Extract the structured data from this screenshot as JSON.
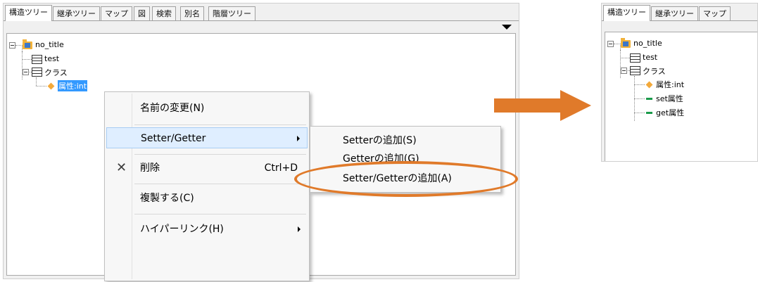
{
  "left_panel": {
    "tabs": [
      "構造ツリー",
      "継承ツリー",
      "マップ",
      "図",
      "検索",
      "別名",
      "階層ツリー"
    ],
    "tree": {
      "root": "no_title",
      "test": "test",
      "class": "クラス",
      "attribute": "属性:int"
    }
  },
  "context_menu": {
    "items": [
      {
        "label": "名前の変更(N)",
        "shortcut": "",
        "submenu": false
      },
      {
        "label": "Setter/Getter",
        "shortcut": "",
        "submenu": true
      },
      {
        "label": "削除",
        "shortcut": "Ctrl+D",
        "submenu": false,
        "icon": "delete-x-icon"
      },
      {
        "label": "複製する(C)",
        "shortcut": "",
        "submenu": false
      },
      {
        "label": "ハイパーリンク(H)",
        "shortcut": "",
        "submenu": true
      }
    ],
    "submenu": [
      "Setterの追加(S)",
      "Getterの追加(G)",
      "Setter/Getterの追加(A)"
    ]
  },
  "right_panel": {
    "tabs": [
      "構造ツリー",
      "継承ツリー",
      "マップ"
    ],
    "tree": {
      "root": "no_title",
      "test": "test",
      "class": "クラス",
      "attribute": "属性:int",
      "setter": "set属性",
      "getter": "get属性"
    }
  },
  "colors": {
    "highlight": "#e07a2a",
    "selection": "#3399ff",
    "arrow": "#e07a2a"
  }
}
